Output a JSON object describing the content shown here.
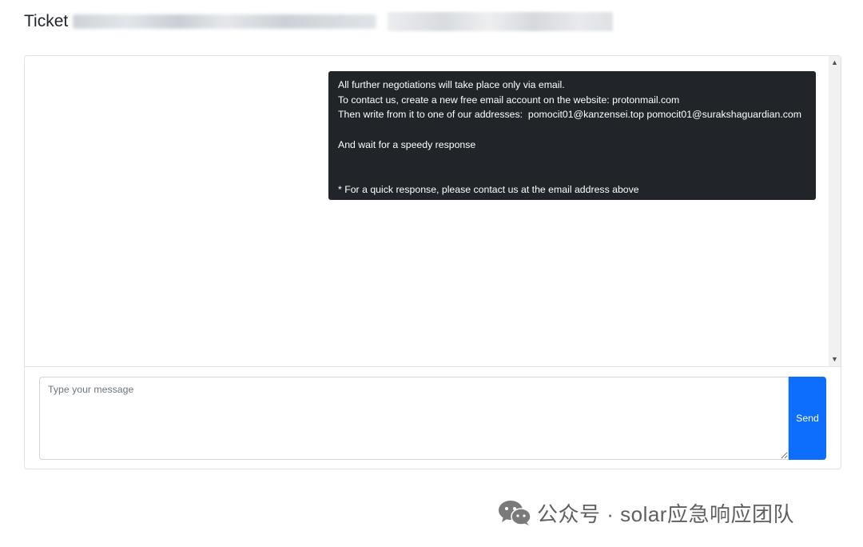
{
  "header": {
    "ticket_label": "Ticket"
  },
  "message": {
    "lines": [
      "All further negotiations will take place only via email.",
      "To contact us, create a new free email account on the website: protonmail.com",
      "Then write from it to one of our addresses:  pomocit01@kanzensei.top pomocit01@surakshaguardian.com",
      "",
      "And wait for a speedy response",
      "",
      "",
      "* For a quick response, please contact us at the email address above"
    ]
  },
  "composer": {
    "placeholder": "Type your message",
    "send_label": "Send"
  },
  "scrollbar": {
    "up_icon": "scroll-up-arrow",
    "down_icon": "scroll-down-arrow"
  },
  "watermark": {
    "icon": "wechat-icon",
    "text": "公众号 · solar应急响应团队"
  },
  "colors": {
    "bubble_bg": "#212529",
    "send_button": "#0d6efd",
    "border": "#dee2e6"
  }
}
